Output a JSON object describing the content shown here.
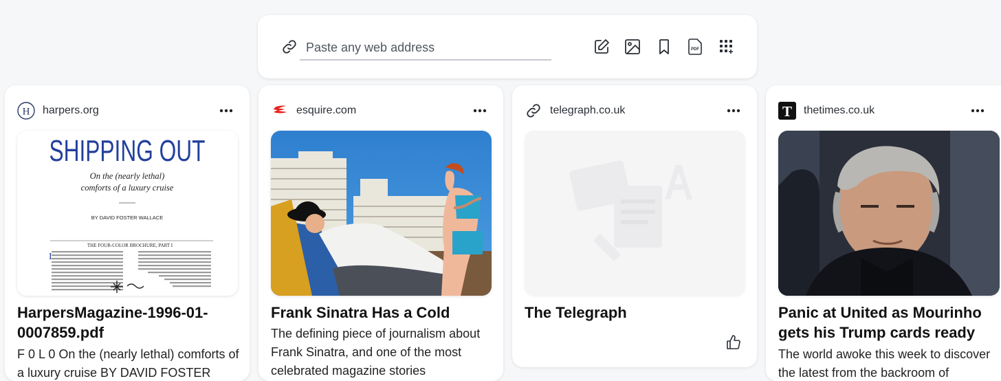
{
  "address_bar": {
    "placeholder": "Paste any web address",
    "tools": [
      "note-icon",
      "image-icon",
      "bookmark-icon",
      "pdf-icon",
      "apps-grid-icon"
    ],
    "pdf_icon_label": "PDF"
  },
  "cards": [
    {
      "domain": "harpers.org",
      "favicon": "H",
      "thumb_title": "SHIPPING OUT",
      "thumb_subtitle": "On the (nearly lethal) comforts of a luxury cruise",
      "thumb_byline": "BY DAVID FOSTER WALLACE",
      "thumb_section": "THE FOUR-COLOR BROCHURE, PART I",
      "title": "HarpersMagazine-1996-01-0007859.pdf",
      "description": "F 0 L 0 On the (nearly lethal) comforts of a luxury cruise BY DAVID FOSTER"
    },
    {
      "domain": "esquire.com",
      "favicon": "E",
      "title": "Frank Sinatra Has a Cold",
      "description": "The defining piece of journalism about Frank Sinatra, and one of the most celebrated magazine stories"
    },
    {
      "domain": "telegraph.co.uk",
      "favicon": "link-icon",
      "title": "The Telegraph",
      "description": ""
    },
    {
      "domain": "thetimes.co.uk",
      "favicon": "T",
      "title": "Panic at United as Mourinho gets his Trump cards ready",
      "description": "The world awoke this week to discover the latest from the backroom of"
    }
  ],
  "colors": {
    "background": "#f6f7f9",
    "esquire_red": "#e8211d",
    "harpers_blue": "#23409c"
  }
}
